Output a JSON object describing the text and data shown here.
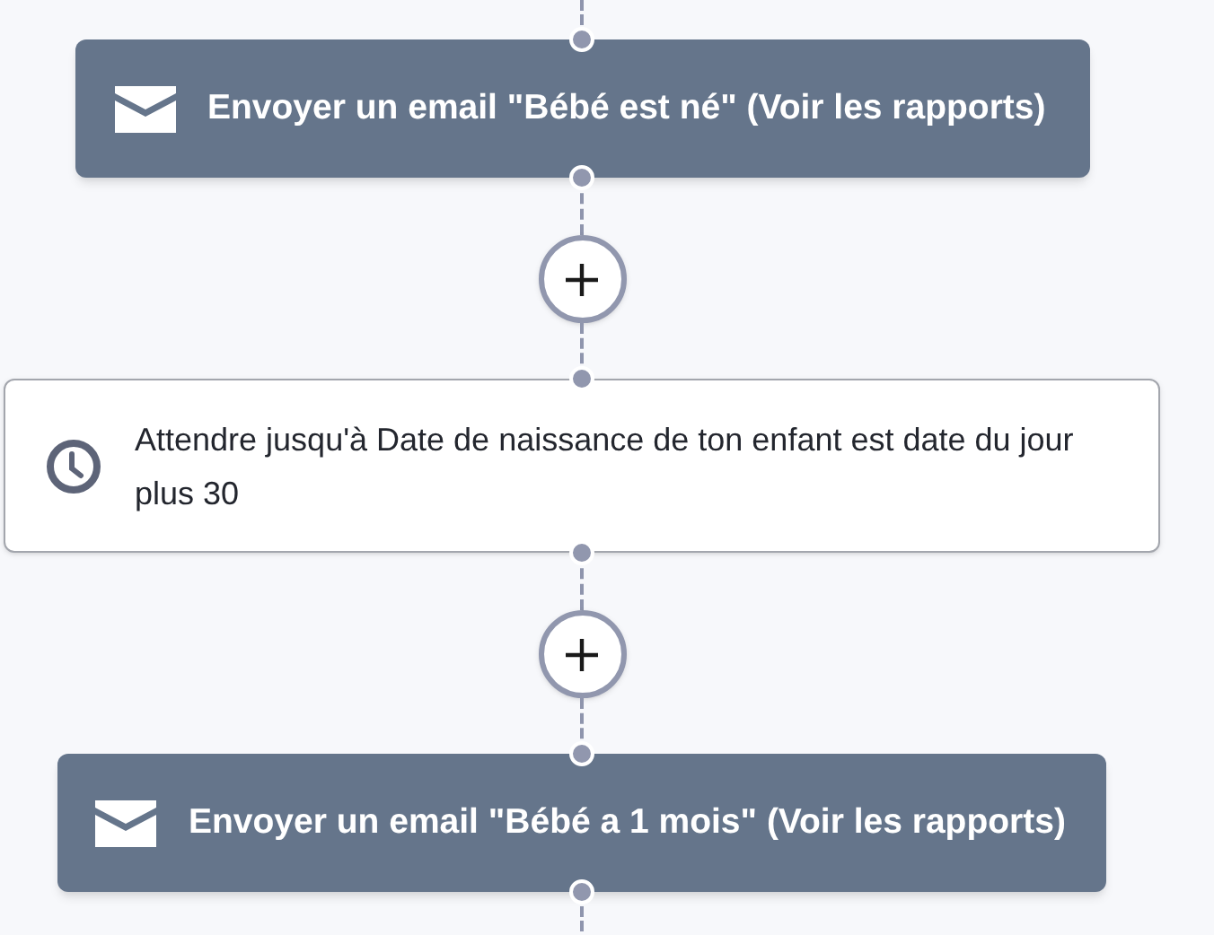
{
  "workflow": [
    {
      "kind": "email",
      "label": "Envoyer un email \"Bébé est né\" (Voir les rapports)"
    },
    {
      "kind": "add"
    },
    {
      "kind": "wait",
      "label": "Attendre jusqu'à Date de naissance de ton enfant est date du jour plus 30"
    },
    {
      "kind": "add"
    },
    {
      "kind": "email",
      "label": "Envoyer un email \"Bébé a 1 mois\" (Voir les rapports)"
    }
  ]
}
